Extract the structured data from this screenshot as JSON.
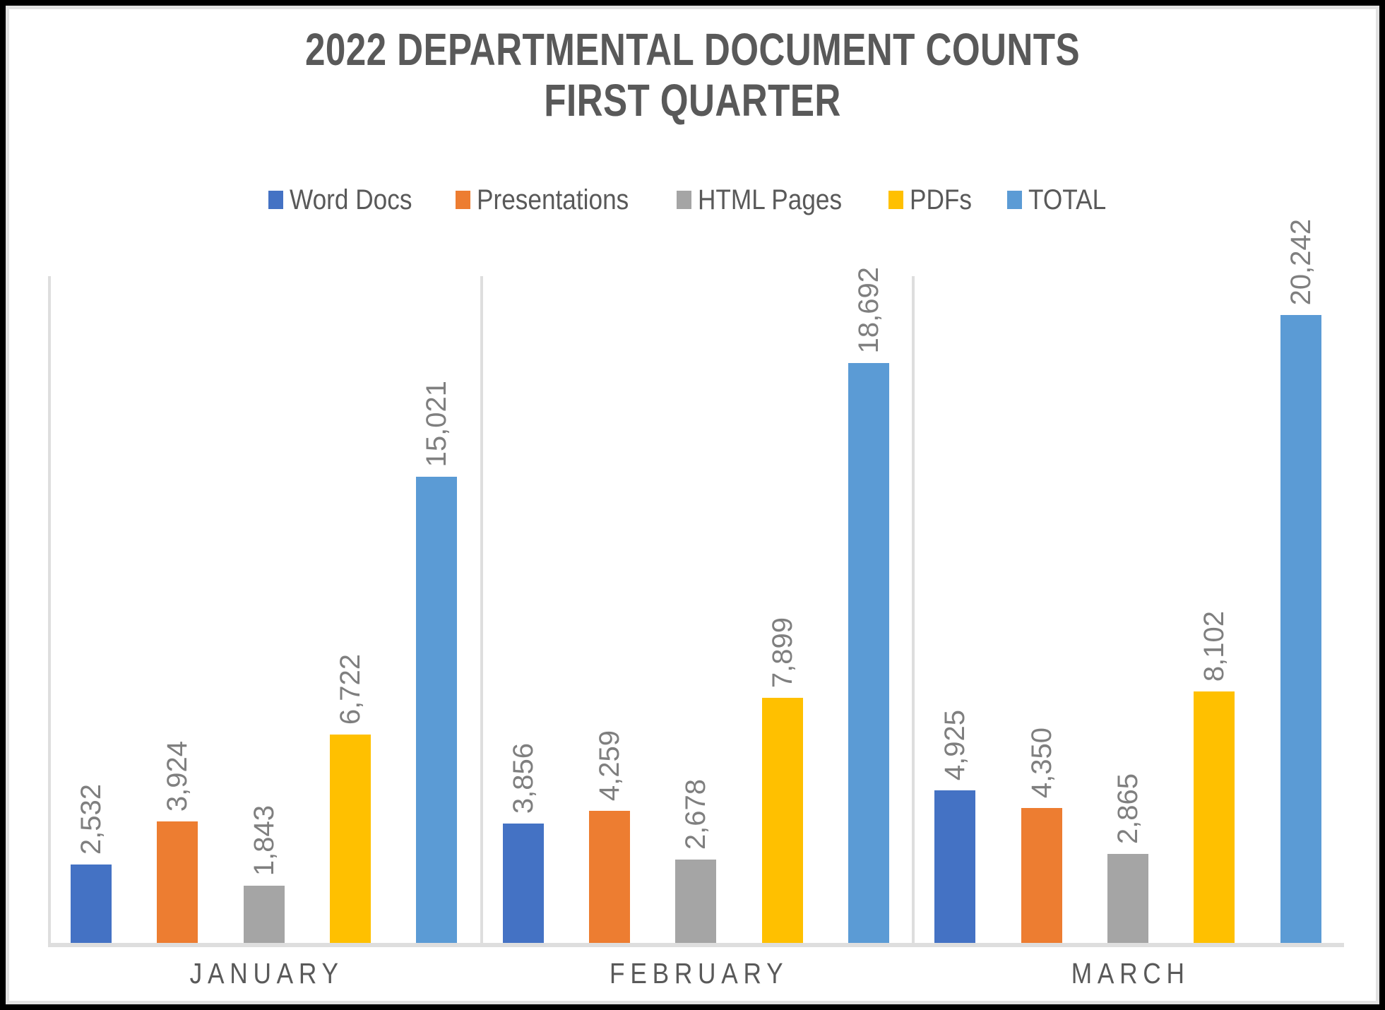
{
  "chart_data": {
    "type": "bar",
    "title": "2022 DEPARTMENTAL DOCUMENT COUNTS FIRST QUARTER",
    "title_lines": [
      "2022 DEPARTMENTAL DOCUMENT COUNTS",
      "FIRST QUARTER"
    ],
    "xlabel": "",
    "ylabel": "",
    "ylim": [
      0,
      21500
    ],
    "grid": false,
    "legend_position": "top",
    "axis_line_color": "#DEDEDE",
    "label_color": "#7F7F7F",
    "title_color": "#595959",
    "categories": [
      "JANUARY",
      "FEBRUARY",
      "MARCH"
    ],
    "series": [
      {
        "name": "Word Docs",
        "color": "#4472C4",
        "values": [
          2532,
          3856,
          4925
        ],
        "value_labels": [
          "2,532",
          "3,856",
          "4,925"
        ]
      },
      {
        "name": "Presentations",
        "color": "#ED7D31",
        "values": [
          3924,
          4259,
          4350
        ],
        "value_labels": [
          "3,924",
          "4,259",
          "4,350"
        ]
      },
      {
        "name": "HTML Pages",
        "color": "#A5A5A5",
        "values": [
          1843,
          2678,
          2865
        ],
        "value_labels": [
          "1,843",
          "2,678",
          "2,865"
        ]
      },
      {
        "name": "PDFs",
        "color": "#FFC000",
        "values": [
          6722,
          7899,
          8102
        ],
        "value_labels": [
          "6,722",
          "7,899",
          "8,102"
        ]
      },
      {
        "name": "TOTAL",
        "color": "#5B9BD5",
        "values": [
          15021,
          18692,
          20242
        ],
        "value_labels": [
          "15,021",
          "18,692",
          "20,242"
        ]
      }
    ]
  },
  "frame": {
    "border_color": "#000000",
    "inner_edge_color": "#E2E2E2",
    "background_color": "#FFFFFF"
  }
}
